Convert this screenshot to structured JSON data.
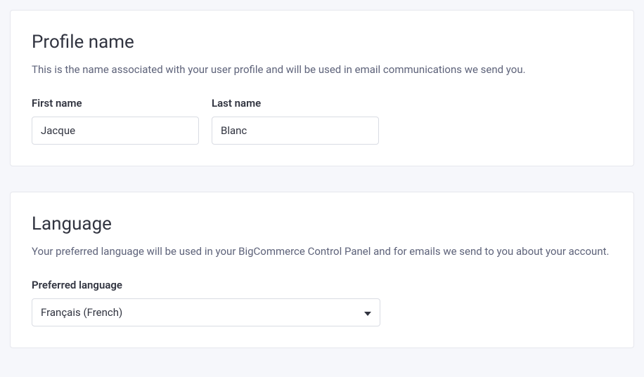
{
  "profile": {
    "title": "Profile name",
    "description": "This is the name associated with your user profile and will be used in email communications we send you.",
    "first_name_label": "First name",
    "first_name_value": "Jacque",
    "last_name_label": "Last name",
    "last_name_value": "Blanc"
  },
  "language": {
    "title": "Language",
    "description": "Your preferred language will be used in your BigCommerce Control Panel and for emails we send to you about your account.",
    "preferred_label": "Preferred language",
    "selected": "Français (French)"
  }
}
